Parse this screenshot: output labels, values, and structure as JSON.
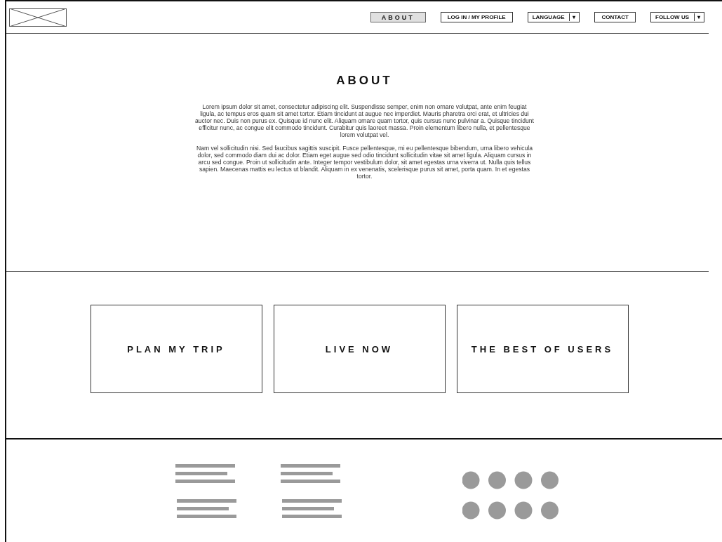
{
  "nav": [
    {
      "label": "ABOUT",
      "selected": true,
      "kind": "link"
    },
    {
      "label": "LOG IN / MY PROFILE",
      "selected": false,
      "kind": "link"
    },
    {
      "label": "LANGUAGE",
      "selected": false,
      "kind": "dropdown",
      "caret": "▾"
    },
    {
      "label": "CONTACT",
      "selected": false,
      "kind": "link"
    },
    {
      "label": "FOLLOW US",
      "selected": false,
      "kind": "dropdown",
      "caret": "▾"
    }
  ],
  "about": {
    "heading": "ABOUT",
    "paragraphs": [
      "Lorem ipsum dolor sit amet, consectetur adipiscing elit. Suspendisse semper, enim non ornare volutpat, ante enim feugiat ligula, ac tempus eros quam sit amet tortor. Etiam tincidunt at augue nec imperdiet. Mauris pharetra orci erat, et ultricies dui auctor nec. Duis non purus ex. Quisque id nunc elit. Aliquam ornare quam tortor, quis cursus nunc pulvinar a. Quisque tincidunt efficitur nunc, ac congue elit commodo tincidunt. Curabitur quis laoreet massa. Proin elementum libero nulla, et pellentesque lorem volutpat vel.",
      "Nam vel sollicitudin nisi. Sed faucibus sagittis suscipit. Fusce pellentesque, mi eu pellentesque bibendum, urna libero vehicula dolor, sed commodo diam dui ac dolor. Etiam eget augue sed odio tincidunt sollicitudin vitae sit amet ligula. Aliquam cursus in arcu sed congue. Proin ut sollicitudin ante. Integer tempor vestibulum dolor, sit amet egestas urna viverra ut. Nulla quis tellus sapien. Maecenas mattis eu lectus ut blandit. Aliquam in ex venenatis, scelerisque purus sit amet, porta quam. In et egestas tortor."
    ]
  },
  "cards": [
    "PLAN MY TRIP",
    "LIVE NOW",
    "THE BEST OF USERS"
  ]
}
